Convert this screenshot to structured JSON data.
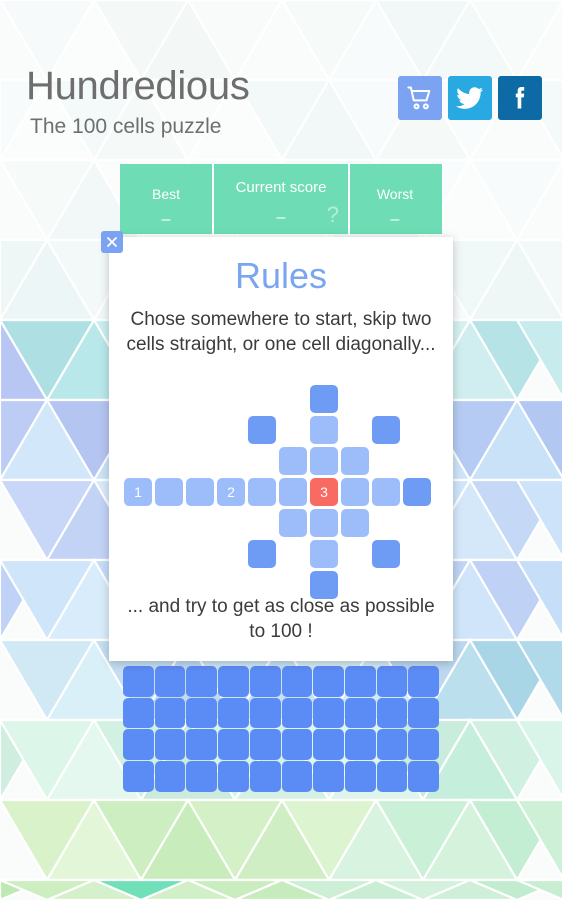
{
  "header": {
    "title": "Hundredious",
    "subtitle": "The 100 cells puzzle",
    "social": [
      {
        "name": "cart-icon",
        "label": "Store",
        "color": "#7ba3f2"
      },
      {
        "name": "twitter-icon",
        "label": "Twitter",
        "color": "#29a9e1"
      },
      {
        "name": "facebook-icon",
        "label": "Facebook",
        "color": "#0d6aa5"
      }
    ]
  },
  "scorebar": {
    "background": "#6edcb4",
    "best_label": "Best",
    "best_value": "–",
    "current_label": "Current score",
    "current_value": "–",
    "worst_label": "Worst",
    "worst_value": "–",
    "help_glyph": "?"
  },
  "dialog": {
    "title": "Rules",
    "title_color": "#7aa5f0",
    "close_glyph": "✕",
    "text_top": "Chose somewhere to start, skip two cells straight, or one cell diagonally...",
    "text_bottom": "... and try to get as close as possible to 100 !",
    "diagram": {
      "cols": 10,
      "rows": 7,
      "cell_size": 28,
      "gap": 3,
      "colors": {
        "move": "#6e9cf4",
        "skip": "#9dbcfa",
        "here": "#f96a63"
      },
      "cells": [
        {
          "col": 6,
          "row": 0,
          "kind": "move",
          "label": ""
        },
        {
          "col": 4,
          "row": 1,
          "kind": "move",
          "label": ""
        },
        {
          "col": 6,
          "row": 1,
          "kind": "skip",
          "label": ""
        },
        {
          "col": 8,
          "row": 1,
          "kind": "move",
          "label": ""
        },
        {
          "col": 5,
          "row": 2,
          "kind": "skip",
          "label": ""
        },
        {
          "col": 6,
          "row": 2,
          "kind": "skip",
          "label": ""
        },
        {
          "col": 7,
          "row": 2,
          "kind": "skip",
          "label": ""
        },
        {
          "col": 0,
          "row": 3,
          "kind": "skip",
          "label": "1"
        },
        {
          "col": 1,
          "row": 3,
          "kind": "skip",
          "label": ""
        },
        {
          "col": 2,
          "row": 3,
          "kind": "skip",
          "label": ""
        },
        {
          "col": 3,
          "row": 3,
          "kind": "skip",
          "label": "2"
        },
        {
          "col": 4,
          "row": 3,
          "kind": "skip",
          "label": ""
        },
        {
          "col": 5,
          "row": 3,
          "kind": "skip",
          "label": ""
        },
        {
          "col": 6,
          "row": 3,
          "kind": "here",
          "label": "3"
        },
        {
          "col": 7,
          "row": 3,
          "kind": "skip",
          "label": ""
        },
        {
          "col": 8,
          "row": 3,
          "kind": "skip",
          "label": ""
        },
        {
          "col": 9,
          "row": 3,
          "kind": "move",
          "label": ""
        },
        {
          "col": 5,
          "row": 4,
          "kind": "skip",
          "label": ""
        },
        {
          "col": 6,
          "row": 4,
          "kind": "skip",
          "label": ""
        },
        {
          "col": 7,
          "row": 4,
          "kind": "skip",
          "label": ""
        },
        {
          "col": 4,
          "row": 5,
          "kind": "move",
          "label": ""
        },
        {
          "col": 6,
          "row": 5,
          "kind": "skip",
          "label": ""
        },
        {
          "col": 8,
          "row": 5,
          "kind": "move",
          "label": ""
        },
        {
          "col": 6,
          "row": 6,
          "kind": "move",
          "label": ""
        }
      ]
    }
  },
  "board": {
    "columns": 10,
    "visible_rows": 4,
    "cell_color": "#5b8cf5"
  }
}
